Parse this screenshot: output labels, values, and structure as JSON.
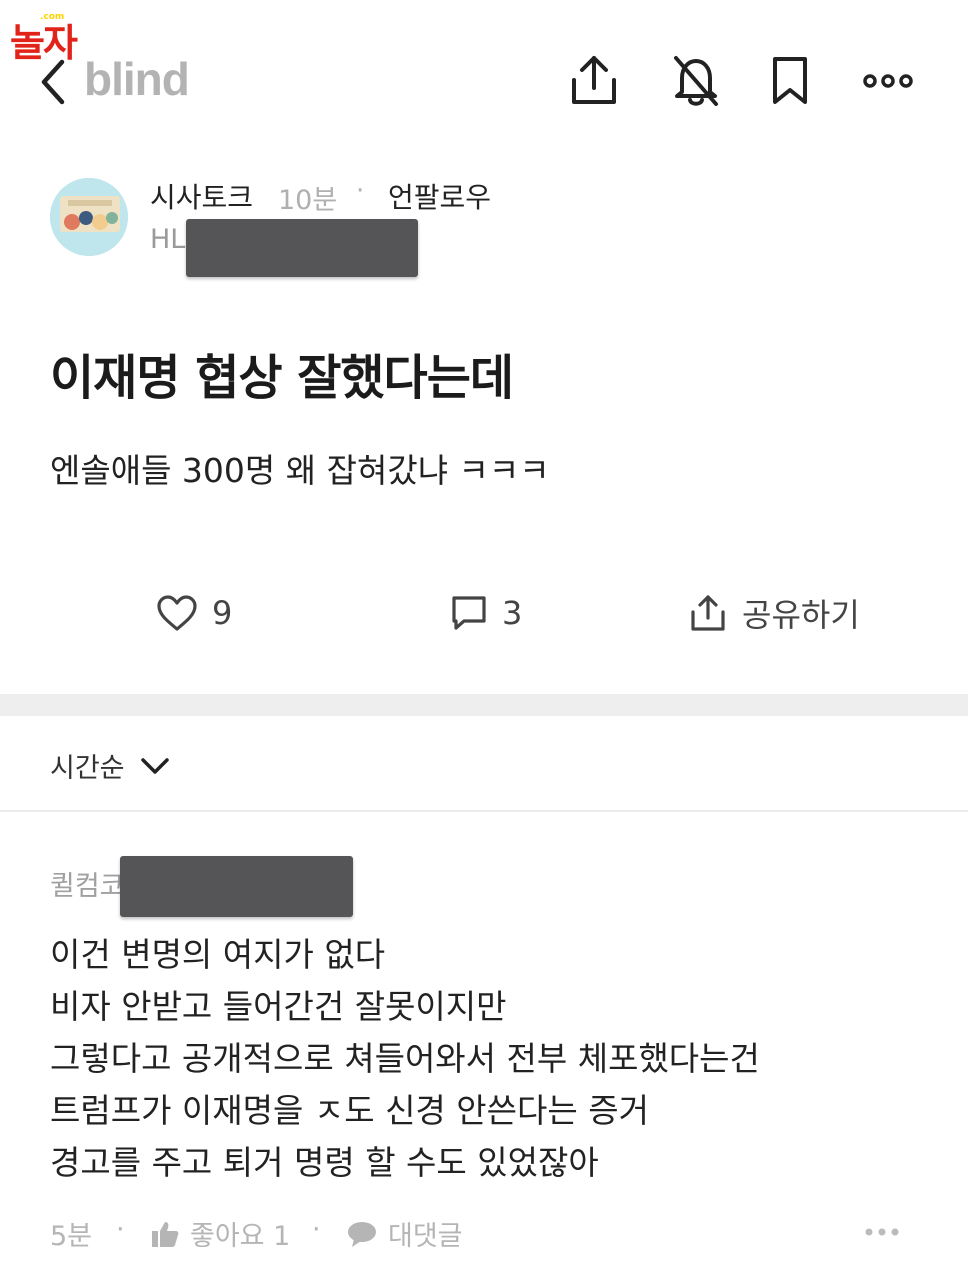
{
  "watermark": {
    "text": "놀자",
    "small": ".com"
  },
  "header": {
    "logo": "blind",
    "icons": [
      "chevron-left-icon",
      "share-icon",
      "bell-off-icon",
      "bookmark-icon",
      "more-icon"
    ]
  },
  "post": {
    "channel": "시사토크",
    "time": "10분",
    "separator": "·",
    "company": "언팔로우",
    "author_prefix": "HL",
    "title": "이재명 협상 잘했다는데",
    "body": "엔솔애들 300명 왜 잡혀갔냐 ㅋㅋㅋ",
    "likes": "9",
    "comments": "3",
    "share_label": "공유하기"
  },
  "sort": {
    "label": "시간순"
  },
  "comment": {
    "author_prefix": "퀼컴코",
    "lines": [
      "이건 변명의 여지가 없다",
      "비자 안받고 들어간건 잘못이지만",
      "그렇다고 공개적으로 쳐들어와서 전부 체포했다는건",
      "트럼프가 이재명을 ㅈ도 신경 안쓴다는 증거",
      "경고를 주고 퇴거 명령 할 수도 있었잖아"
    ],
    "time": "5분",
    "like_label": "좋아요 1",
    "reply_label": "대댓글",
    "meta_separator": "·"
  },
  "colors": {
    "logo": "#b3b3b3",
    "watermark": "#e2231a",
    "band": "#eeeeef"
  }
}
